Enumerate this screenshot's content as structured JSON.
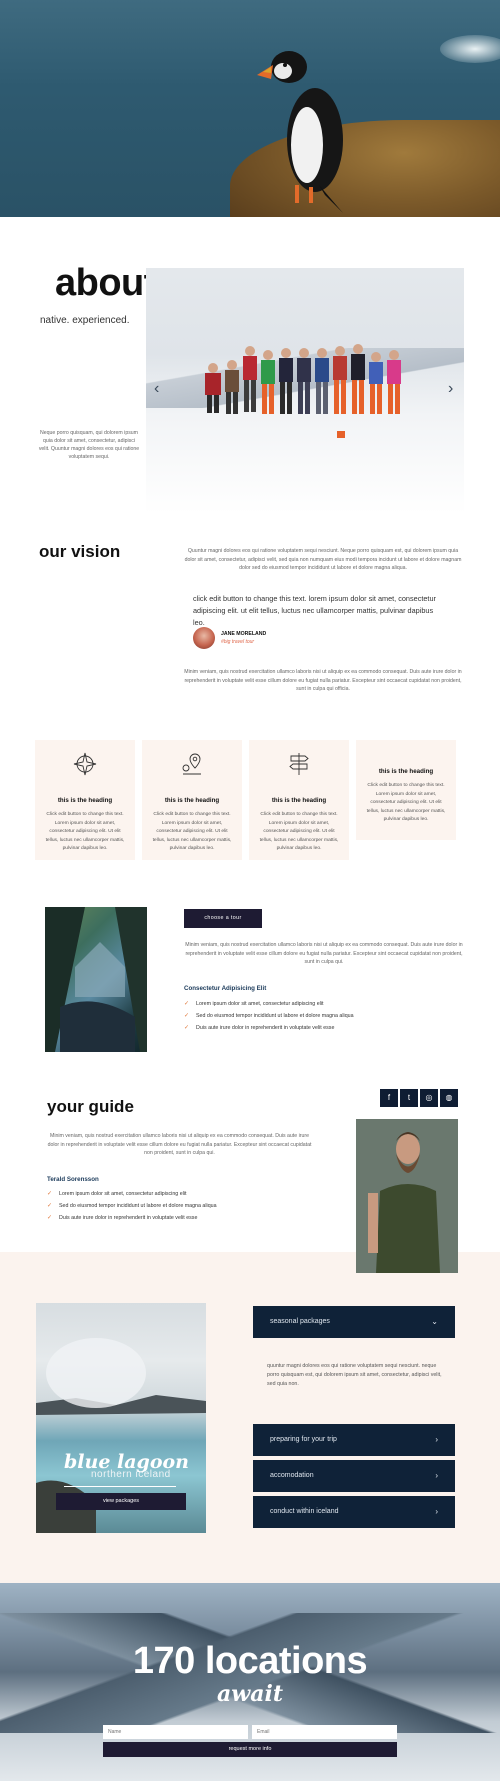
{
  "hero": {
    "image": "puffin on cliff above sea"
  },
  "about": {
    "title": "about",
    "subtitle": "native. experienced.",
    "text": "Neque porro quisquam, qui dolorem ipsum quia dolor sit amet, consectetur, adipisci velit. Quuntur magni dolores eos qui ratione voluptatem sequi.",
    "slider_prev": "‹",
    "slider_next": "›"
  },
  "vision": {
    "title": "our vision",
    "paragraph1": "Quuntur magni dolores eos qui ratione voluptatem sequi nesciunt. Neque porro quisquam est, qui dolorem ipsum quia dolor sit amet, consectetur, adipisci velit, sed quia non numquam eius modi tempora incidunt ut labore et dolore magnam dolor sed do eiusmod tempor incididunt ut labore et dolore magna aliqua.",
    "quote": "click edit button to change this text. lorem ipsum dolor sit amet, consectetur adipiscing elit. ut elit tellus, luctus nec ullamcorper mattis, pulvinar dapibus leo.",
    "author_name": "JANE MORELAND",
    "author_role": "#big travel tour",
    "paragraph2": "Minim veniam, quis nostrud exercitation ullamco laboris nisi ut aliquip ex ea commodo consequat. Duis aute irure dolor in reprehenderit in voluptate velit esse cillum dolore eu fugiat nulla pariatur. Excepteur sint occaecat cupidatat non proident, sunt in culpa qui officia."
  },
  "cards": [
    {
      "icon": "compass-icon",
      "heading": "this is the heading",
      "text": "Click edit button to change this text. Lorem ipsum dolor sit amet, consectetur adipiscing elit. Ut elit tellus, luctus nec ullamcorper mattis, pulvinar dapibus leo."
    },
    {
      "icon": "map-pin-icon",
      "heading": "this is the heading",
      "text": "Click edit button to change this text. Lorem ipsum dolor sit amet, consectetur adipiscing elit. Ut elit tellus, luctus nec ullamcorper mattis, pulvinar dapibus leo."
    },
    {
      "icon": "signpost-icon",
      "heading": "this is the heading",
      "text": "Click edit button to change this text. Lorem ipsum dolor sit amet, consectetur adipiscing elit. Ut elit tellus, luctus nec ullamcorper mattis, pulvinar dapibus leo."
    },
    {
      "icon": "",
      "heading": "this is the heading",
      "text": "Click edit button to change this text. Lorem ipsum dolor sit amet, consectetur adipiscing elit. Ut elit tellus, luctus nec ullamcorper mattis, pulvinar dapibus leo."
    }
  ],
  "tour": {
    "button": "choose a tour",
    "text": "Minim veniam, quis nostrud exercitation ullamco laboris nisi ut aliquip ex ea commodo consequat. Duis aute irure dolor in reprehenderit in voluptate velit esse cillum dolore eu fugiat nulla pariatur. Excepteur sint occaecat cupidatat non proident, sunt in culpa qui.",
    "list_title": "Consectetur Adipisicing Elit",
    "list": [
      "Lorem ipsum dolor sit amet, consectetur adipiscing elit",
      "Sed do eiusmod tempor incididunt ut labore et dolore magna aliqua",
      "Duis aute irure dolor in reprehenderit in voluptate velit esse"
    ]
  },
  "guide": {
    "title": "your guide",
    "social": [
      "f",
      "t",
      "◎",
      "◍"
    ],
    "text": "Minim veniam, quis nostrud exercitation ullamco laboris nisi ut aliquip ex ea commodo consequat. Duis aute irure dolor in reprehenderit in voluptate velit esse cillum dolore eu fugiat nulla pariatur. Excepteur sint occaecat cupidatat non proident, sunt in culpa qui.",
    "name": "Terald Sorensson",
    "list": [
      "Lorem ipsum dolor sit amet, consectetur adipiscing elit",
      "Sed do eiusmod tempor incididunt ut labore et dolore magna aliqua",
      "Duis aute irure dolor in reprehenderit in voluptate velit esse"
    ]
  },
  "packages": {
    "lagoon_title": "blue lagoon",
    "lagoon_sub": "northern iceland",
    "view_button": "view packages",
    "accordion": [
      {
        "label": "seasonal packages",
        "arrow": "⌄"
      },
      {
        "label": "preparing for your trip",
        "arrow": "›"
      },
      {
        "label": "accomodation",
        "arrow": "›"
      },
      {
        "label": "conduct within iceland",
        "arrow": "›"
      }
    ],
    "open_text": "quuntur magni dolores eos qui ratione voluptatem sequi nesciunt. neque porro quisquam est, qui dolorem ipsum sit amet, consectetur, adipisci velit, sed quia non."
  },
  "cta": {
    "title": "170 locations",
    "script": "await",
    "name_placeholder": "Name",
    "email_placeholder": "Email",
    "submit": "request more info"
  },
  "colors": {
    "navy": "#0f2238",
    "dark_button": "#1e1b33",
    "accent": "#e06a4e",
    "cream": "#fcf4ef"
  }
}
